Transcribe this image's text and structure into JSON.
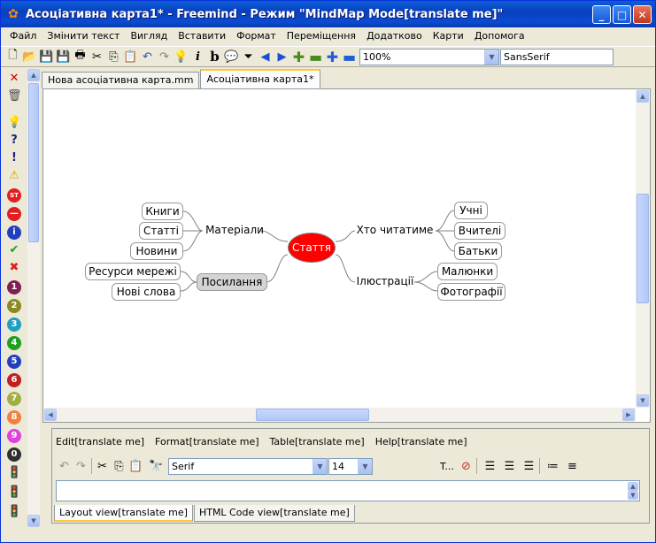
{
  "window": {
    "title": "Асоціативна карта1* - Freemind - Режим \"MindMap Mode[translate me]\"",
    "min": "_",
    "max": "□",
    "close": "✕"
  },
  "menu": [
    "Файл",
    "Змінити текст",
    "Вигляд",
    "Вставити",
    "Формат",
    "Переміщення",
    "Додатково",
    "Карти",
    "Допомога"
  ],
  "toolbar": {
    "zoom": "100%",
    "font": "SansSerif"
  },
  "tabs": [
    "Нова асоціативна карта.mm",
    "Асоціативна карта1*"
  ],
  "map": {
    "root": "Стаття",
    "left": {
      "materials": {
        "label": "Матеріали",
        "children": [
          "Книги",
          "Статті",
          "Новини"
        ]
      },
      "links": {
        "label": "Посилання",
        "children": [
          "Ресурси мережі",
          "Нові слова"
        ]
      }
    },
    "right": {
      "readers": {
        "label": "Хто читатиме",
        "children": [
          "Учні",
          "Вчителі",
          "Батьки"
        ]
      },
      "illustrations": {
        "label": "Ілюстрації",
        "children": [
          "Малюнки",
          "Фотографії"
        ]
      }
    }
  },
  "editor": {
    "menu": [
      "Edit[translate me]",
      "Format[translate me]",
      "Table[translate me]",
      "Help[translate me]"
    ],
    "font": "Serif",
    "size": "14",
    "text_button": "T...",
    "tabs": [
      "Layout view[translate me]",
      "HTML Code view[translate me]"
    ]
  },
  "colors": {
    "root": "#ff0000",
    "title_bar": "#0a3fbd",
    "tab_accent": "#ffc83c"
  }
}
